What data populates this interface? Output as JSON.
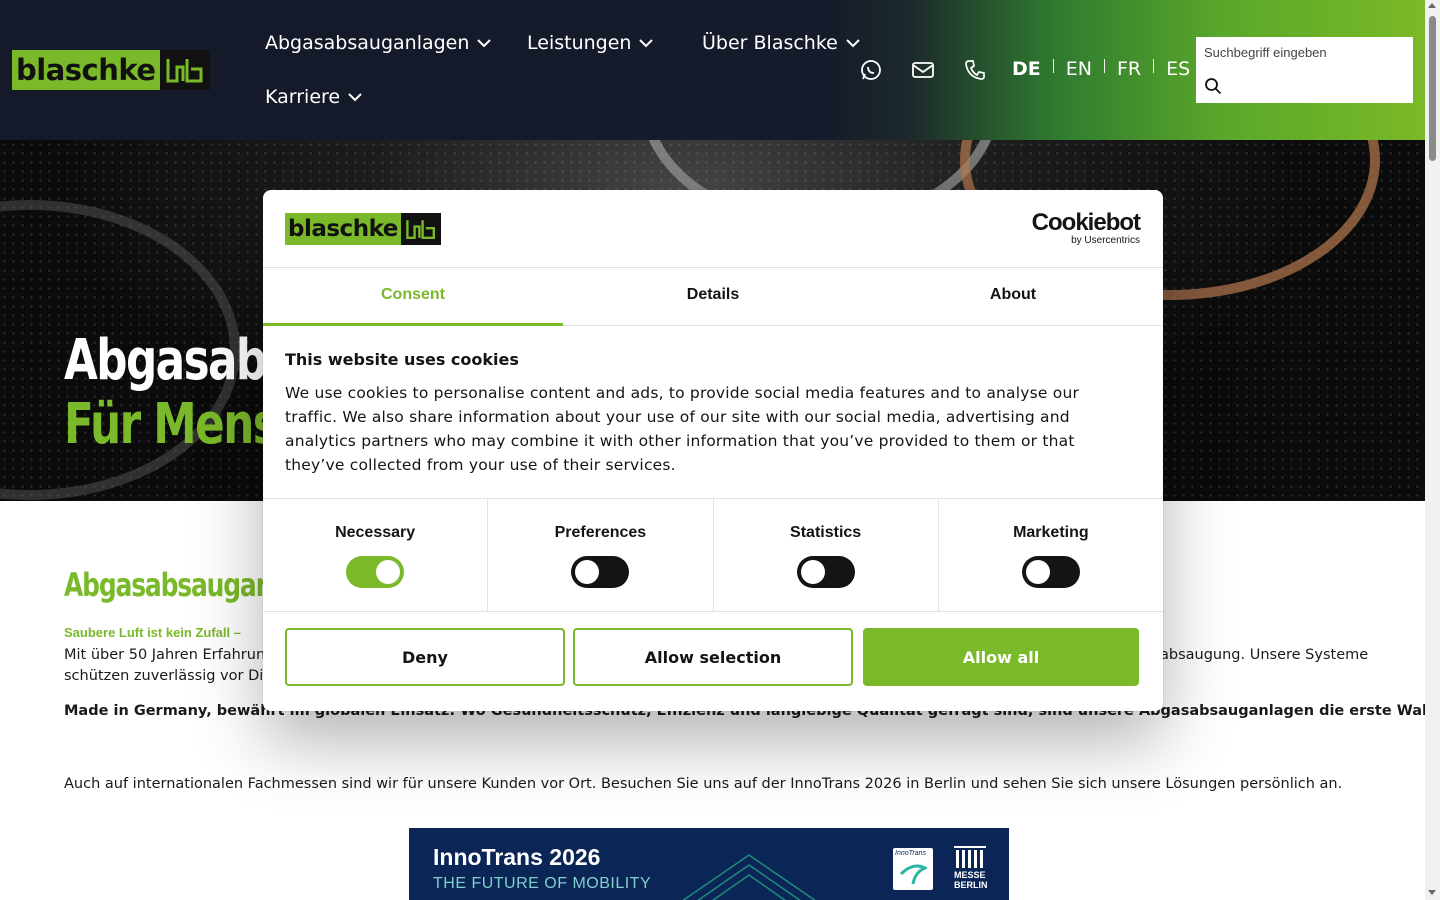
{
  "header": {
    "logo_text": "blaschke",
    "nav": [
      {
        "label": "Abgasabsauganlagen"
      },
      {
        "label": "Leistungen"
      },
      {
        "label": "Über Blaschke"
      },
      {
        "label": "Karriere"
      }
    ],
    "icons": [
      "whatsapp-icon",
      "mail-icon",
      "phone-icon"
    ],
    "languages": [
      "DE",
      "EN",
      "FR",
      "ES"
    ],
    "active_language": "DE",
    "search": {
      "label": "Suchbegriff eingeben",
      "value": ""
    }
  },
  "hero": {
    "title_line1": "Abgasabs",
    "title_line2": "Für Mensc"
  },
  "content": {
    "heading": "Abgasabsauganl",
    "lead": "Saubere Luft ist kein Zufall –",
    "para_left_line1": "Mit über 50 Jahren Erfahrung",
    "para_left_line2": "schützen zuverlässig vor Dies",
    "para_right": "absaugung. Unsere Systeme",
    "bold_line": "Made in Germany, bewährt im globalen Einsatz: Wo Gesundheitsschutz, Effizienz und langlebige Qualität gefragt sind, sind unsere Abgasabsauganlagen die erste Wahl.",
    "messe_line": "Auch auf internationalen Fachmessen sind wir für unsere Kunden vor Ort. Besuchen Sie uns auf der InnoTrans 2026 in Berlin und sehen Sie sich unsere Lösungen persönlich an.",
    "banner": {
      "title": "InnoTrans 2026",
      "subtitle": "THE FUTURE OF MOBILITY",
      "logo1": "InnoTrans",
      "logo2": "MESSE BERLIN"
    }
  },
  "cookie_dialog": {
    "logo_text": "blaschke",
    "provider": "Cookiebot",
    "provider_sub": "by Usercentrics",
    "tabs": [
      {
        "label": "Consent",
        "active": true
      },
      {
        "label": "Details",
        "active": false
      },
      {
        "label": "About",
        "active": false
      }
    ],
    "title": "This website uses cookies",
    "text": "We use cookies to personalise content and ads, to provide social media features and to analyse our traffic. We also share information about your use of our site with our social media, advertising and analytics partners who may combine it with other information that you’ve provided to them or that they’ve collected from your use of their services.",
    "toggles": [
      {
        "label": "Necessary",
        "on": true
      },
      {
        "label": "Preferences",
        "on": false
      },
      {
        "label": "Statistics",
        "on": false
      },
      {
        "label": "Marketing",
        "on": false
      }
    ],
    "buttons": {
      "deny": "Deny",
      "allow_selection": "Allow selection",
      "allow_all": "Allow all"
    }
  },
  "colors": {
    "brand_green": "#7ab929",
    "header_dark": "#151b2a",
    "text_dark": "#141414"
  }
}
